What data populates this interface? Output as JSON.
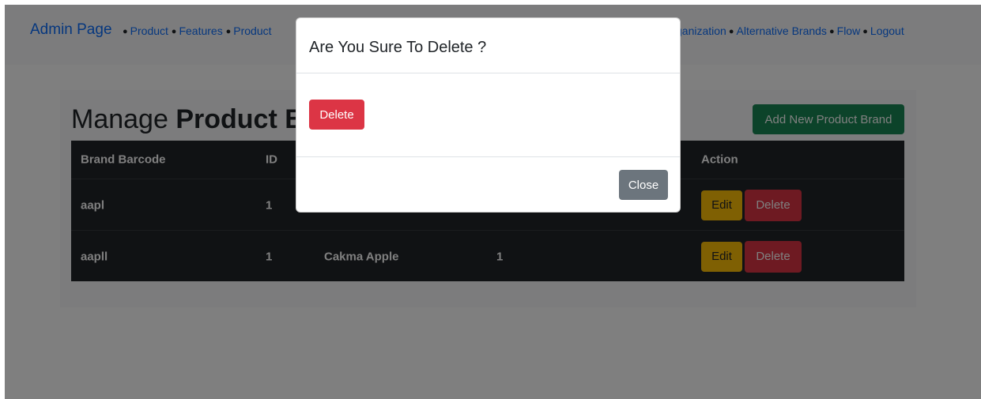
{
  "navbar": {
    "brand": "Admin Page",
    "links_left": [
      "Product",
      "Features",
      "Product"
    ],
    "links_right": [
      "ganization",
      "Alternative Brands",
      "Flow",
      "Logout"
    ]
  },
  "page": {
    "title_light": "Manage ",
    "title_bold": "Product Br",
    "add_button": "Add New Product Brand"
  },
  "table": {
    "headers": [
      "Brand Barcode",
      "ID",
      "",
      "",
      "Action"
    ],
    "rows": [
      {
        "barcode": "aapl",
        "id": "1",
        "name": "",
        "col4": ""
      },
      {
        "barcode": "aapll",
        "id": "1",
        "name": "Cakma Apple",
        "col4": "1"
      }
    ],
    "edit_label": "Edit",
    "delete_label": "Delete"
  },
  "modal": {
    "title": "Are You Sure To Delete ?",
    "delete_label": "Delete",
    "close_label": "Close"
  },
  "colors": {
    "primary": "#0d6efd",
    "danger": "#dc3545",
    "success": "#198754",
    "warning": "#ffc107",
    "secondary": "#6c757d",
    "dark": "#212529"
  }
}
